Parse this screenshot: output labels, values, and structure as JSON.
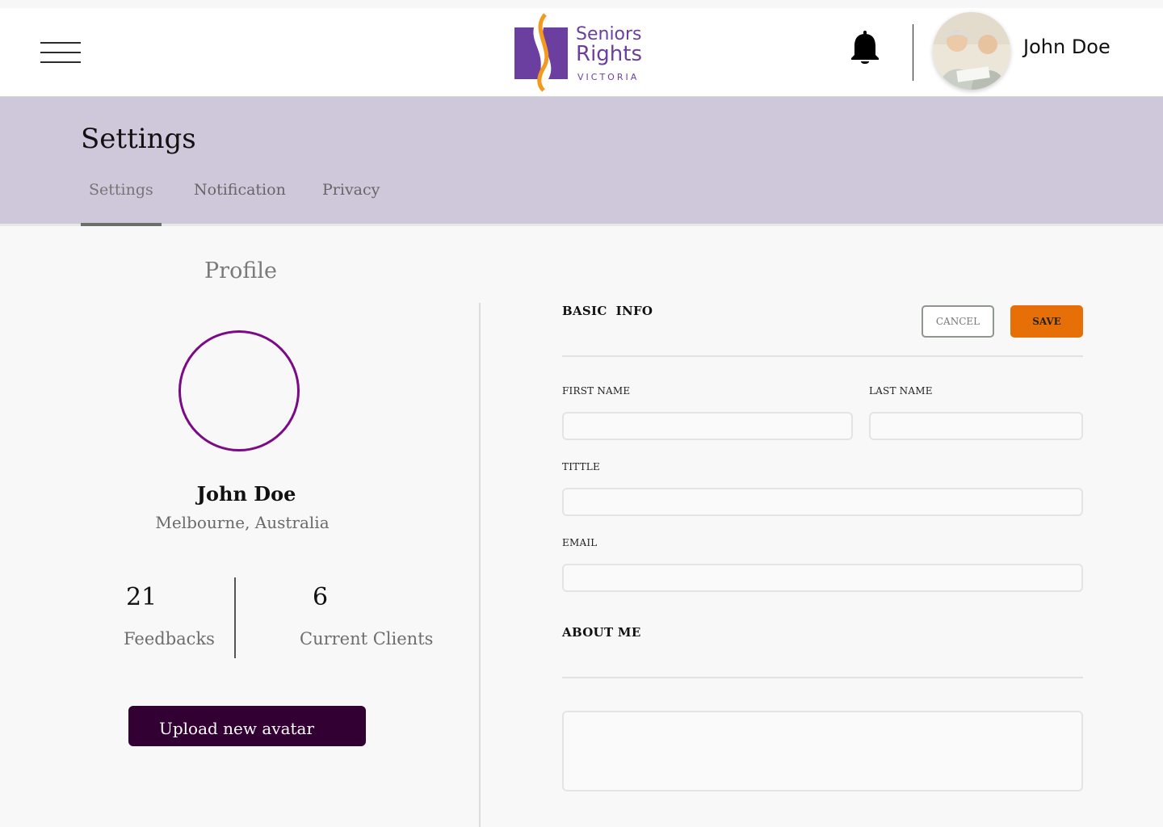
{
  "header": {
    "logo": {
      "line1": "Seniors",
      "line2": "Rights",
      "line3": "VICTORIA"
    },
    "user_name": "John Doe",
    "icons": {
      "menu": "hamburger-menu-icon",
      "notifications": "bell-icon"
    }
  },
  "page": {
    "title": "Settings",
    "tabs": [
      {
        "label": "Settings",
        "active": true
      },
      {
        "label": "Notification",
        "active": false
      },
      {
        "label": "Privacy",
        "active": false
      }
    ]
  },
  "profile": {
    "heading": "Profile",
    "name": "John Doe",
    "location": "Melbourne, Australia",
    "stats": [
      {
        "value": "21",
        "label": "Feedbacks"
      },
      {
        "value": "6",
        "label": "Current Clients"
      }
    ],
    "upload_label": "Upload new avatar"
  },
  "basic_info": {
    "heading": "BASIC  INFO",
    "cancel_label": "CANCEL",
    "save_label": "SAVE",
    "fields": {
      "first_name_label": "FIRST NAME",
      "first_name_value": "",
      "last_name_label": "LAST NAME",
      "last_name_value": "",
      "title_label": "TITTLE",
      "title_value": "",
      "email_label": "EMAIL",
      "email_value": ""
    }
  },
  "about_me": {
    "heading": "ABOUT ME",
    "value": ""
  },
  "colors": {
    "band": "#cfc7da",
    "accent_orange": "#e67007",
    "avatar_ring": "#7b0a87",
    "upload_button": "#330033",
    "logo_purple": "#6a3fa0",
    "logo_orange": "#f39a1e"
  }
}
